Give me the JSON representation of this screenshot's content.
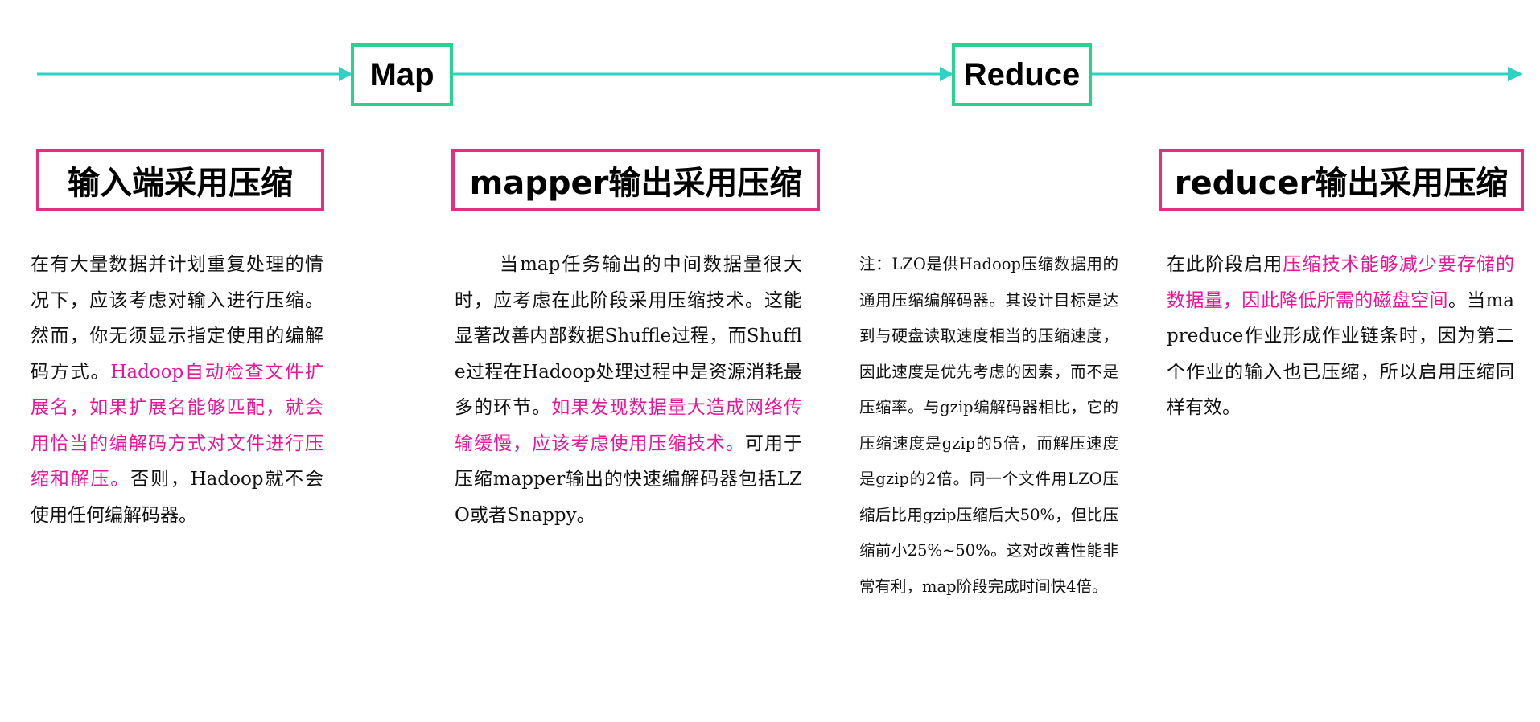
{
  "flow": {
    "stages": [
      "Map",
      "Reduce"
    ]
  },
  "colors": {
    "arrow": "#2ed1c4",
    "stage_border": "#27d38f",
    "title_border": "#e52e7f",
    "highlight": "#e7179a"
  },
  "sections": {
    "input": {
      "title": "输入端采用压缩",
      "text_1": "在有大量数据并计划重复处理的情况下，应该考虑对输入进行压缩。然而，你无须显示指定使用的编解码方式。",
      "highlight": "Hadoop自动检查文件扩展名，如果扩展名能够匹配，就会用恰当的编解码方式对文件进行压缩和解压。",
      "text_2": "否则，Hadoop就不会使用任何编解码器。"
    },
    "mapper": {
      "title": "mapper输出采用压缩",
      "text_1": "当map任务输出的中间数据量很大时，应考虑在此阶段采用压缩技术。这能显著改善内部数据Shuffle过程，而Shuffle过程在Hadoop处理过程中是资源消耗最多的环节。",
      "highlight": "如果发现数据量大造成网络传输缓慢，应该考虑使用压缩技术。",
      "text_2": "可用于压缩mapper输出的快速编解码器包括LZO或者Snappy。"
    },
    "note": {
      "text": "注：LZO是供Hadoop压缩数据用的通用压缩编解码器。其设计目标是达到与硬盘读取速度相当的压缩速度，因此速度是优先考虑的因素，而不是压缩率。与gzip编解码器相比，它的压缩速度是gzip的5倍，而解压速度是gzip的2倍。同一个文件用LZO压缩后比用gzip压缩后大50%，但比压缩前小25%~50%。这对改善性能非常有利，map阶段完成时间快4倍。"
    },
    "reducer": {
      "title": "reducer输出采用压缩",
      "text_1": "在此阶段启用",
      "highlight": "压缩技术能够减少要存储的数据量，因此降低所需的磁盘空间",
      "text_2": "。当mapreduce作业形成作业链条时，因为第二个作业的输入也已压缩，所以启用压缩同样有效。"
    }
  }
}
